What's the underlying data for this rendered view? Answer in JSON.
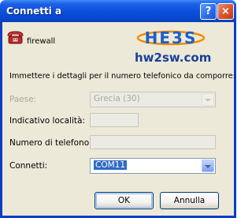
{
  "window": {
    "title": "Connetti a"
  },
  "titlebar_buttons": {
    "help_glyph": "?",
    "close_glyph": "×"
  },
  "icons": {
    "phone": "telephone-icon",
    "help": "help-icon",
    "close": "close-icon",
    "dropdown": "chevron-down-icon"
  },
  "connection": {
    "name": "firewall"
  },
  "logo": {
    "text": "hw2sw.com",
    "mark_text": "HE3S"
  },
  "instructions": "Immettere i dettagli per il numero telefonico da comporre:",
  "form": {
    "country_label": "Paese:",
    "country_value": "Grecia (30)",
    "area_code_label": "Indicativo località:",
    "area_code_value": "",
    "phone_label": "Numero di telefono:",
    "phone_value": "",
    "connect_label": "Connetti:",
    "connect_value": "COM11"
  },
  "buttons": {
    "ok": "OK",
    "cancel": "Annulla"
  },
  "colors": {
    "titlebar": "#0a4fdc",
    "dialog_bg": "#ece9d8",
    "selection": "#316ac5",
    "logo_orange": "#f28c00",
    "logo_blue": "#1a5fcc"
  }
}
